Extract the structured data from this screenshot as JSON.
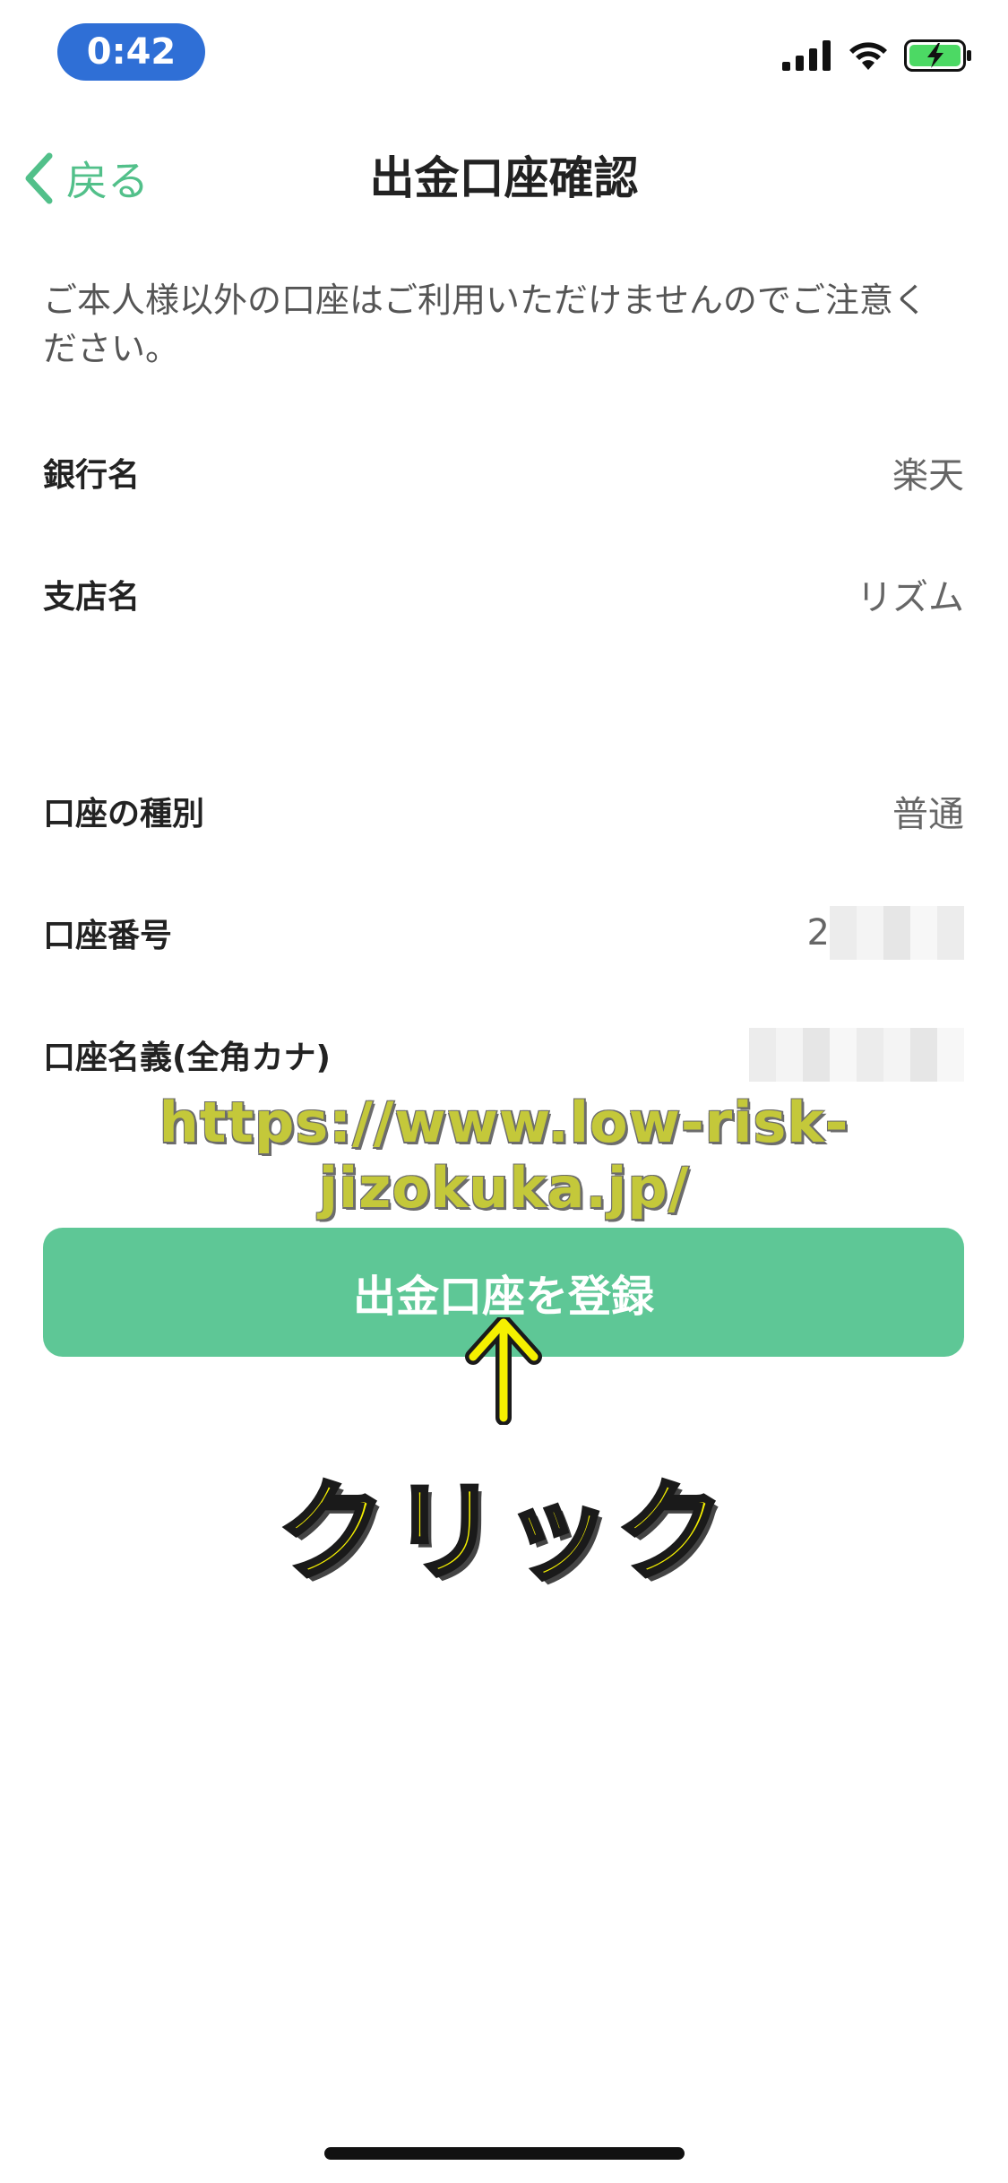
{
  "status_bar": {
    "time": "0:42",
    "icons": [
      "signal-icon",
      "wifi-icon",
      "battery-charging-icon"
    ]
  },
  "nav": {
    "back_label": "戻る",
    "title": "出金口座確認"
  },
  "notice": "ご本人様以外の口座はご利用いただけませんのでご注意ください。",
  "fields": {
    "bank_name": {
      "label": "銀行名",
      "value": "楽天"
    },
    "branch_name": {
      "label": "支店名",
      "value": "リズム"
    },
    "account_type": {
      "label": "口座の種別",
      "value": "普通"
    },
    "account_number": {
      "label": "口座番号",
      "value": "2"
    },
    "account_holder": {
      "label": "口座名義(全角カナ)",
      "value": ""
    }
  },
  "watermark": "https://www.low-risk-jizokuka.jp/",
  "register_button_label": "出金口座を登録",
  "annotation": {
    "arrow": "↑",
    "click": "クリック"
  },
  "colors": {
    "accent": "#52c08a",
    "button": "#5ec796",
    "time_pill": "#2f6fd6",
    "annotation_yellow": "#f5f000"
  }
}
